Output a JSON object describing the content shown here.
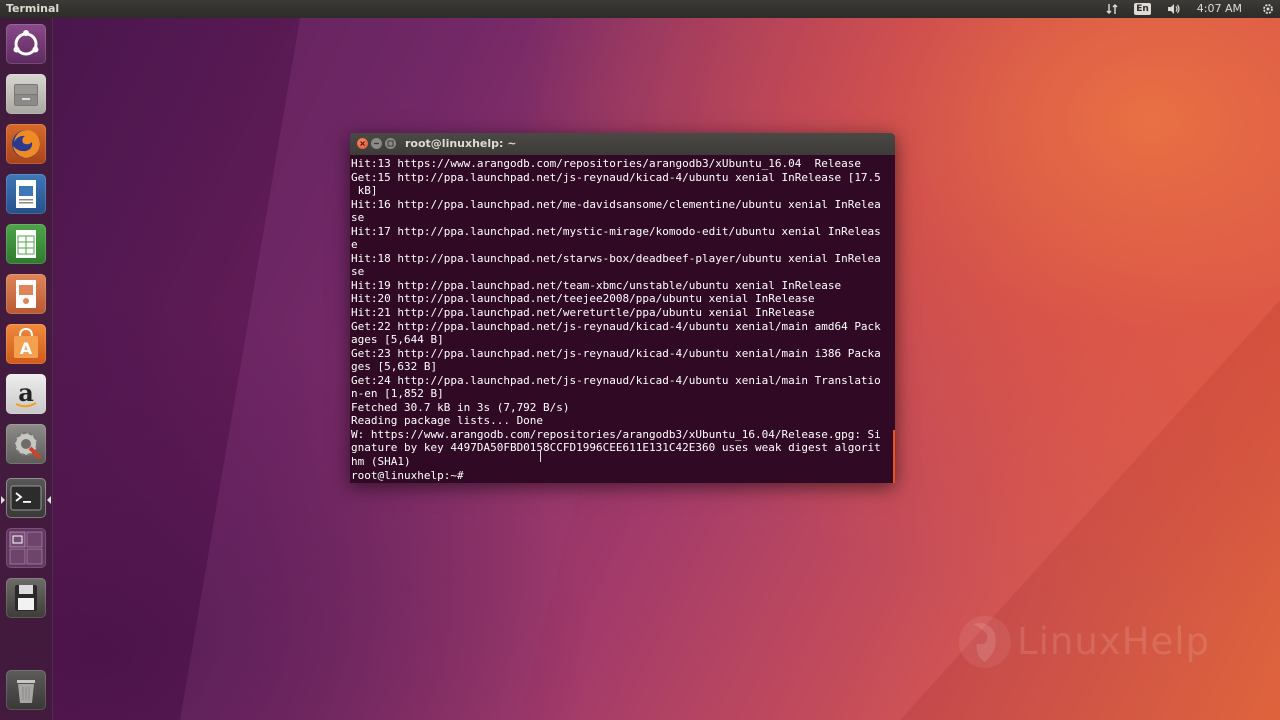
{
  "top_panel": {
    "app_title": "Terminal",
    "language": "En",
    "clock": "4:07 AM"
  },
  "launcher": {
    "items": [
      {
        "name": "dash-icon"
      },
      {
        "name": "files-icon"
      },
      {
        "name": "firefox-icon"
      },
      {
        "name": "writer-icon"
      },
      {
        "name": "calc-icon"
      },
      {
        "name": "impress-icon"
      },
      {
        "name": "software-center-icon"
      },
      {
        "name": "amazon-icon"
      },
      {
        "name": "system-settings-icon"
      },
      {
        "name": "terminal-icon"
      },
      {
        "name": "workspace-switcher-icon"
      },
      {
        "name": "floppy-icon"
      },
      {
        "name": "trash-icon"
      }
    ]
  },
  "terminal": {
    "title": "root@linuxhelp: ~",
    "output": "Hit:13 https://www.arangodb.com/repositories/arangodb3/xUbuntu_16.04  Release\nGet:15 http://ppa.launchpad.net/js-reynaud/kicad-4/ubuntu xenial InRelease [17.5\n kB]\nHit:16 http://ppa.launchpad.net/me-davidsansome/clementine/ubuntu xenial InRelea\nse\nHit:17 http://ppa.launchpad.net/mystic-mirage/komodo-edit/ubuntu xenial InReleas\ne\nHit:18 http://ppa.launchpad.net/starws-box/deadbeef-player/ubuntu xenial InRelea\nse\nHit:19 http://ppa.launchpad.net/team-xbmc/unstable/ubuntu xenial InRelease\nHit:20 http://ppa.launchpad.net/teejee2008/ppa/ubuntu xenial InRelease\nHit:21 http://ppa.launchpad.net/wereturtle/ppa/ubuntu xenial InRelease\nGet:22 http://ppa.launchpad.net/js-reynaud/kicad-4/ubuntu xenial/main amd64 Pack\nages [5,644 B]\nGet:23 http://ppa.launchpad.net/js-reynaud/kicad-4/ubuntu xenial/main i386 Packa\nges [5,632 B]\nGet:24 http://ppa.launchpad.net/js-reynaud/kicad-4/ubuntu xenial/main Translatio\nn-en [1,852 B]\nFetched 30.7 kB in 3s (7,792 B/s)\nReading package lists... Done\nW: https://www.arangodb.com/repositories/arangodb3/xUbuntu_16.04/Release.gpg: Si\ngnature by key 4497DA50FBD0158CCFD1996CEE611E131C42E360 uses weak digest algorit\nhm (SHA1)\nroot@linuxhelp:~# "
  },
  "watermark": {
    "text": "LinuxHelp"
  },
  "colors": {
    "terminal_bg": "#300a24",
    "accent": "#e95420",
    "panel_bg": "#2d2c29"
  }
}
